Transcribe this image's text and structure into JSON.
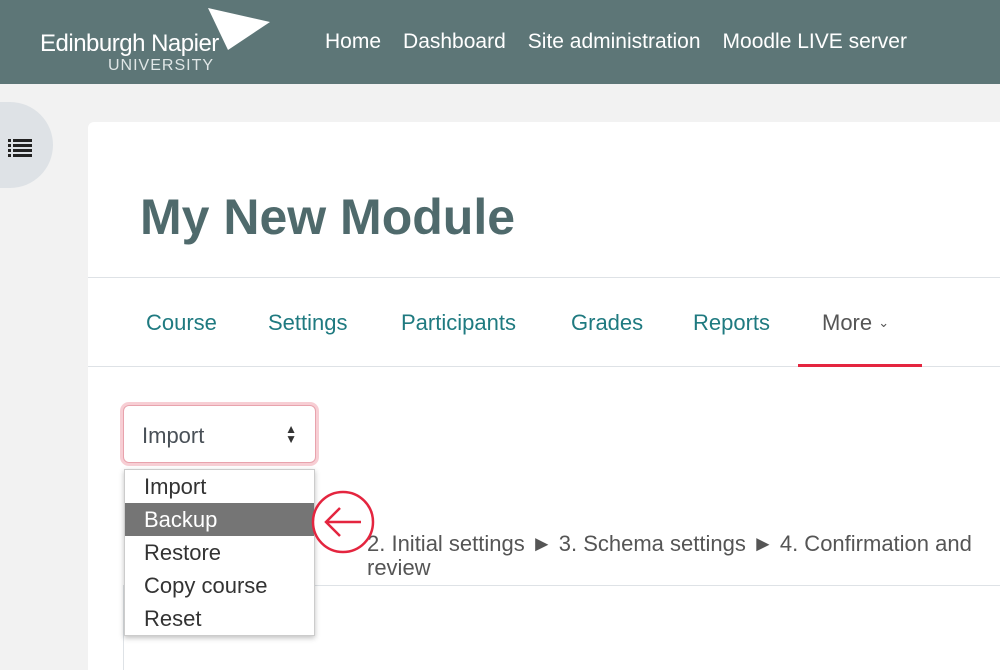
{
  "navbar": {
    "logo_text": "Edinburgh Napier",
    "logo_sub": "UNIVERSITY",
    "links": [
      "Home",
      "Dashboard",
      "Site administration",
      "Moodle LIVE server"
    ]
  },
  "page": {
    "title": "My New Module"
  },
  "tabs": [
    "Course",
    "Settings",
    "Participants",
    "Grades",
    "Reports",
    "More"
  ],
  "select": {
    "value": "Import",
    "options": [
      "Import",
      "Backup",
      "Restore",
      "Copy course",
      "Reset"
    ],
    "highlighted": "Backup"
  },
  "steps": {
    "text": "2. Initial settings ► 3. Schema settings ► 4. Confirmation and review"
  },
  "colors": {
    "navbar": "#5d7677",
    "accent": "#e4253f",
    "link": "#1f7a80"
  }
}
